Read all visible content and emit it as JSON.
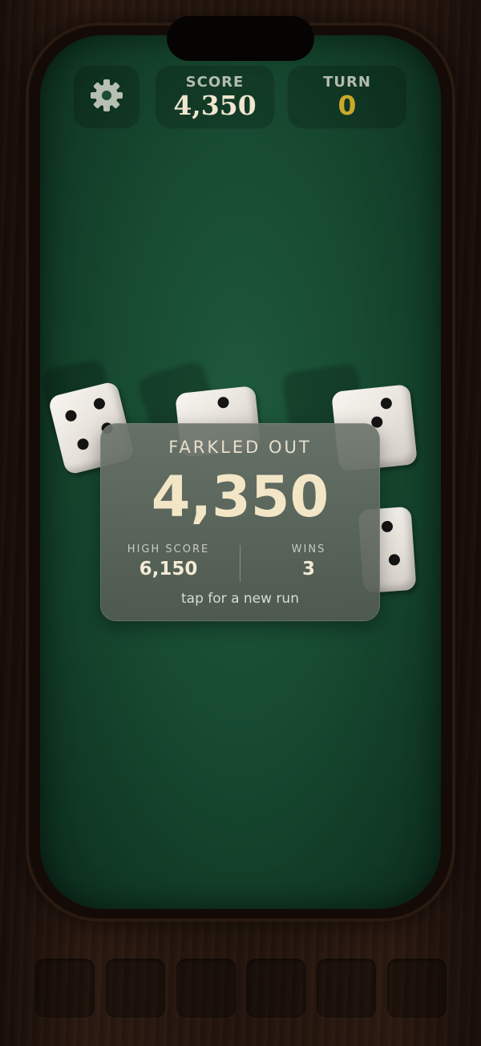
{
  "hud": {
    "settings_icon": "gear-icon",
    "score_label": "SCORE",
    "score_value": "4,350",
    "turn_label": "TURN",
    "turn_value": "0"
  },
  "result": {
    "title": "FARKLED OUT",
    "final_score": "4,350",
    "high_score_label": "HIGH SCORE",
    "high_score_value": "6,150",
    "wins_label": "WINS",
    "wins_value": "3",
    "hint": "tap for a new run"
  },
  "dice": [
    {
      "face": 4
    },
    {
      "face": 2
    },
    {
      "face": 2
    },
    {
      "face": 2
    }
  ],
  "held_slots": [
    {
      "die": null
    },
    {
      "die": null
    },
    {
      "die": null
    },
    {
      "die": null
    },
    {
      "die": null
    },
    {
      "die": null
    }
  ],
  "colors": {
    "felt": "#174a31",
    "wood": "#24160e",
    "turn_accent": "#c9a82a",
    "score_text": "#f0e6cf"
  }
}
